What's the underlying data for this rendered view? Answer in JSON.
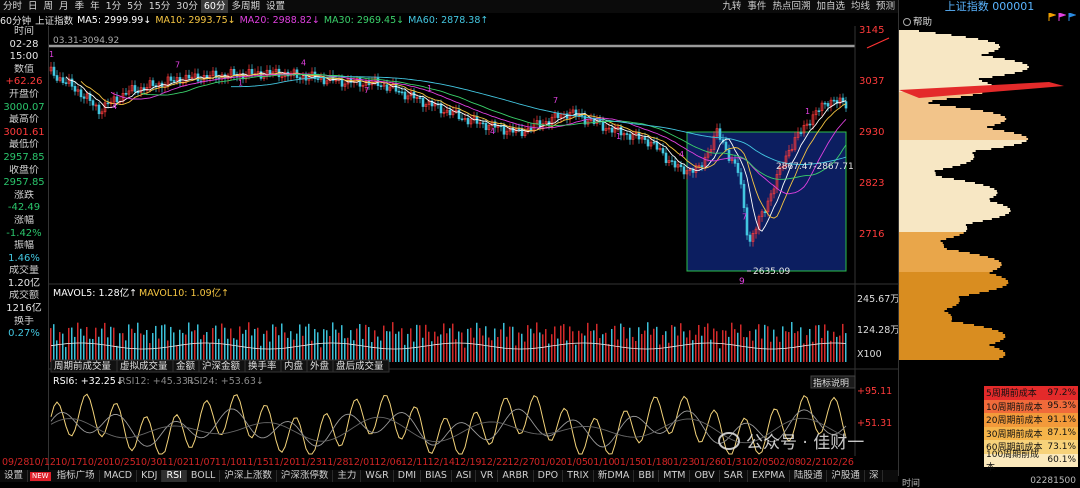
{
  "toolbar": {
    "items": [
      "分时",
      "日",
      "周",
      "月",
      "季",
      "年",
      "1分",
      "5分",
      "15分",
      "30分",
      "60分",
      "多周期",
      "设置"
    ],
    "active": "60分",
    "right_items": [
      "九转",
      "事件",
      "热点回溯",
      "加自选",
      "均线",
      "预测"
    ]
  },
  "ma_legend": {
    "period": "60分钟",
    "index": "上证指数",
    "ma5": "MA5: 2999.99↓",
    "ma10": "MA10: 2993.75↓",
    "ma20": "MA20: 2988.82↓",
    "ma30": "MA30: 2969.45↓",
    "ma60": "MA60: 2878.38↑",
    "colors": {
      "ma5": "#ffffff",
      "ma10": "#f5c542",
      "ma20": "#e040e0",
      "ma30": "#3ad06a",
      "ma60": "#43c6e0"
    }
  },
  "left_info": {
    "time_label": "时间",
    "date": "02-28",
    "time": "15:00",
    "value_label": "数值",
    "value": "+62.26",
    "open_label": "开盘价",
    "open": "3000.07",
    "high_label": "最高价",
    "high": "3001.61",
    "low_label": "最低价",
    "low": "2957.85",
    "close_label": "收盘价",
    "close": "2957.85",
    "chg_label": "涨跌",
    "chg": "-42.49",
    "pct_label": "涨幅",
    "pct": "-1.42%",
    "amp_label": "振幅",
    "amp": "1.46%",
    "vol_label": "成交量",
    "vol": "1.20亿",
    "amt_label": "成交额",
    "amt": "1216亿",
    "turn_label": "换手",
    "turn": "0.27%"
  },
  "chart_data": {
    "type": "candlestick",
    "price_axis": {
      "ticks": [
        3145,
        3037,
        2930,
        2823,
        2716
      ],
      "range": [
        2600,
        3160
      ]
    },
    "annotations": {
      "top_line": "03.31-3094.92",
      "low_marker": "2635.09",
      "range_marker": "2867.47-2867.71"
    },
    "tick_marks": {
      "bottom_count": "9"
    },
    "volume": {
      "mavol5": "MAVOL5: 1.28亿↑",
      "mavol10": "MAVOL10: 1.09亿↑",
      "ticks": [
        "245.67万",
        "124.28万"
      ],
      "unit": "X100"
    },
    "volume_tabs": [
      "周期前成交量",
      "虚拟成交量",
      "金额",
      "沪深金额",
      "换手率",
      "内盘",
      "外盘",
      "盘后成交量"
    ],
    "rsi": {
      "rsi6": "RSI6: +32.25↓",
      "rsi12": "RSI12: +45.33↓",
      "rsi24": "RSI24: +53.63↓",
      "ticks": [
        "+95.11",
        "+51.31"
      ],
      "button": "指标说明"
    },
    "dates": [
      "09/28",
      "10/12",
      "10/17",
      "10/20",
      "10/25",
      "10/30",
      "11/02",
      "11/07",
      "11/10",
      "11/15",
      "11/20",
      "11/23",
      "11/28",
      "12/01",
      "12/06",
      "12/11",
      "12/14",
      "12/19",
      "12/22",
      "12/27",
      "01/02",
      "01/05",
      "01/10",
      "01/15",
      "01/18",
      "01/23",
      "01/26",
      "01/31",
      "02/05",
      "02/08",
      "02/21",
      "02/26"
    ]
  },
  "indicator_tabs": {
    "settings": "设置",
    "new": "NEW",
    "items": [
      "指标广场",
      "MACD",
      "KDJ",
      "RSI",
      "BOLL",
      "沪深上涨数",
      "沪深涨停数",
      "主力",
      "W&R",
      "DMI",
      "BIAS",
      "ASI",
      "VR",
      "ARBR",
      "DPO",
      "TRIX",
      "新DMA",
      "BBI",
      "MTM",
      "OBV",
      "SAR",
      "EXPMA",
      "陆股通",
      "沪股通",
      "深"
    ],
    "active": "RSI"
  },
  "right_panel": {
    "title": "上证指数 000001",
    "help": "帮助",
    "cost_rows": [
      {
        "label": "5周期前成本",
        "value": "97.2%",
        "color": "#e42a2a"
      },
      {
        "label": "10周期前成本",
        "value": "95.3%",
        "color": "#f06a3a"
      },
      {
        "label": "20周期前成本",
        "value": "91.1%",
        "color": "#f39a3a"
      },
      {
        "label": "30周期前成本",
        "value": "87.1%",
        "color": "#f5b44a"
      },
      {
        "label": "60周期前成本",
        "value": "73.1%",
        "color": "#f7d27a"
      },
      {
        "label": "100周期前成本",
        "value": "60.1%",
        "color": "#fbe9bc"
      }
    ]
  },
  "status": {
    "left": "时间",
    "right": "02281500"
  },
  "watermark": "公众号 · 佳财一"
}
